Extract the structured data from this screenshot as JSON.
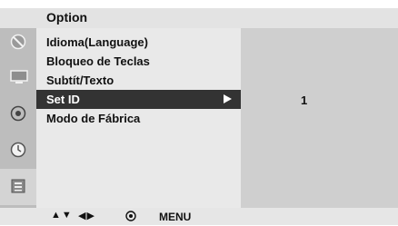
{
  "header": {
    "title": "Option"
  },
  "sidebar": {
    "icons": [
      {
        "name": "picture-icon"
      },
      {
        "name": "tv-icon"
      },
      {
        "name": "disc-icon"
      },
      {
        "name": "clock-icon"
      },
      {
        "name": "option-icon",
        "active": true
      }
    ]
  },
  "menu": {
    "items": [
      {
        "label": "Idioma(Language)",
        "selected": false
      },
      {
        "label": "Bloqueo de Teclas",
        "selected": false
      },
      {
        "label": "Subtít/Texto",
        "selected": false
      },
      {
        "label": "Set ID",
        "selected": true
      },
      {
        "label": "Modo de Fábrica",
        "selected": false
      }
    ]
  },
  "panel": {
    "value": "1"
  },
  "footer": {
    "nav_updown": "▲▼",
    "nav_leftright": "◀▶",
    "menu_label": "MENU"
  },
  "colors": {
    "selected_bg": "#333333",
    "menu_bg": "#e9e9e9",
    "panel_bg": "#cfcfcf",
    "sidebar_bg": "#bdbdbd"
  }
}
